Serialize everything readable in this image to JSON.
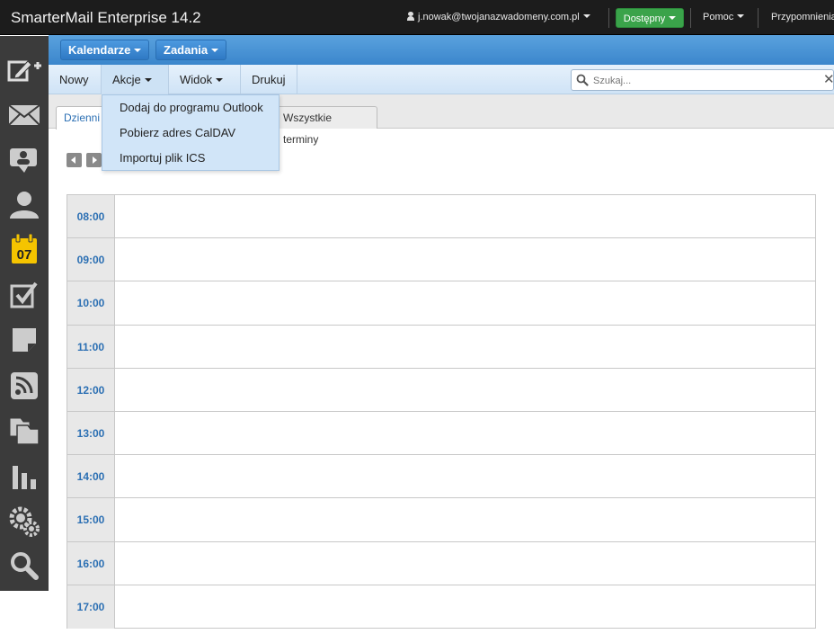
{
  "app": {
    "title": "SmarterMail Enterprise 14.2"
  },
  "topbar": {
    "user": "j.nowak@twojanazwadomeny.com.pl",
    "status": "Dostępny",
    "help": "Pomoc",
    "reminders": "Przypomnienia"
  },
  "sidebar": {
    "items": [
      {
        "icon": "compose-icon"
      },
      {
        "icon": "mail-icon"
      },
      {
        "icon": "chat-icon"
      },
      {
        "icon": "contacts-icon"
      },
      {
        "icon": "calendar-icon",
        "badge": "07"
      },
      {
        "icon": "tasks-icon"
      },
      {
        "icon": "notes-icon"
      },
      {
        "icon": "rss-icon"
      },
      {
        "icon": "files-icon"
      },
      {
        "icon": "reports-icon"
      },
      {
        "icon": "settings-icon"
      },
      {
        "icon": "search-icon"
      }
    ]
  },
  "catbar": {
    "calendars": "Kalendarze",
    "tasks": "Zadania"
  },
  "toolbar": {
    "new": "Nowy",
    "actions": "Akcje",
    "view": "Widok",
    "print": "Drukuj",
    "search_placeholder": "Szukaj..."
  },
  "actions_menu": {
    "items": [
      "Dodaj do programu Outlook",
      "Pobierz adres CalDAV",
      "Importuj plik ICS"
    ]
  },
  "tabs": {
    "daily": "Dzienni",
    "all": "Wszystkie terminy"
  },
  "schedule": {
    "hours": [
      "08:00",
      "09:00",
      "10:00",
      "11:00",
      "12:00",
      "13:00",
      "14:00",
      "15:00",
      "16:00",
      "17:00"
    ]
  },
  "colors": {
    "accent_blue": "#3b86cc",
    "status_green": "#3aa34a",
    "calendar_yellow": "#f5c400",
    "time_blue": "#2b6fb3"
  }
}
